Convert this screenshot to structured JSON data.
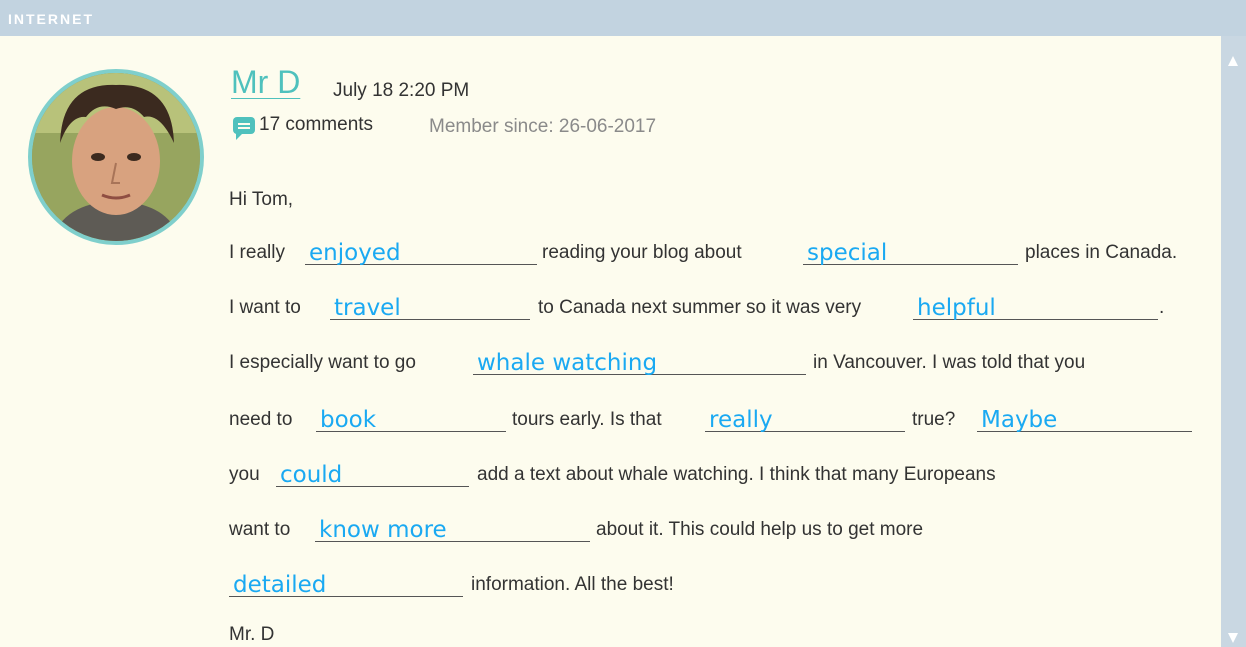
{
  "header": {
    "label": "INTERNET"
  },
  "post": {
    "author": "Mr D",
    "timestamp": "July 18 2:20 PM",
    "comments": "17 comments",
    "member_since": "Member since: 26-06-2017"
  },
  "letter": {
    "greeting": "Hi Tom,",
    "l1a": "I really",
    "l1b": "reading your blog about",
    "l1c": "places in Canada.",
    "l2a": "I want to",
    "l2b": "to Canada next summer so it was very",
    "l2c": ".",
    "l3a": "I especially want to go",
    "l3b": "in Vancouver. I was told that you",
    "l4a": "need to",
    "l4b": "tours early. Is that",
    "l4c": "true?",
    "l5a": "you",
    "l5b": "add a text about whale watching. I think that many Europeans",
    "l6a": "want to",
    "l6b": "about it. This could help us to get more",
    "l7b": "information. All the best!",
    "signoff": "Mr. D"
  },
  "answers": {
    "a1": "enjoyed",
    "a2": "special",
    "a3": "travel",
    "a4": "helpful",
    "a5": "whale watching",
    "a6": "book",
    "a7": "really",
    "a8": "Maybe",
    "a9": "could",
    "a10": "know more",
    "a11": "detailed"
  },
  "colors": {
    "accent": "#4fc1bd",
    "handwriting": "#1aa9f2",
    "topbar": "#c2d3e0"
  },
  "icons": {
    "comment": "speech-bubble-icon",
    "scroll_up": "chevron-up-icon",
    "scroll_down": "chevron-down-icon"
  }
}
